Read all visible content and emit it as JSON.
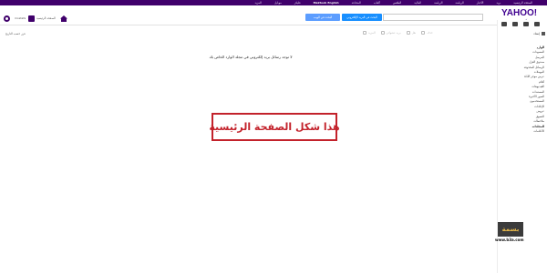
{
  "top_nav": {
    "items": [
      "الصفحة الرئيسية",
      "بريد",
      "الأخبار",
      "الرياضة",
      "الرياضة",
      "المالية",
      "الطقس",
      "ألعاب",
      "المحادثة",
      "Maktoob English",
      "فليكر",
      "موبايل",
      "المزيد"
    ],
    "bold": [
      "Maktoob English"
    ]
  },
  "header": {
    "logo": "YAHOO!",
    "logo_sub": "مكتوب",
    "search_value": "",
    "search_mail_button": "البحث في البريد الإلكتروني",
    "search_web_button": "البحث في الويب",
    "home_label": "الصفحة الرئيسية",
    "user_name": "mostafa"
  },
  "toolbar": {
    "sort_label": "فرز حسب التاريخ",
    "tools": [
      "حذف",
      "نقل",
      "بريد عشوائي",
      "المزيد"
    ]
  },
  "sidebar": {
    "compose": "إنشاء",
    "folders": [
      "الوارد",
      "المسودات",
      "المرسل",
      "صندوق العزل",
      "الرسائل المحذوفة",
      "المهملات",
      "عرض موجز الأداة",
      "أفلام",
      "الفيديوهات",
      "المستندات",
      "الصور الأخيرة",
      "المستخدمون",
      "الإعلانات",
      "عروض",
      "التسوق",
      "ملاحظات",
      "المجلدات",
      "الأعلامات"
    ],
    "sections": [
      "الوارد",
      "المجلدات"
    ]
  },
  "main": {
    "empty_message": "لا توجد رسائل بريد إلكتروني في مجلد الوارد الخاص بك",
    "callout": "هذا شكل الصفحة الرئيسية"
  },
  "watermark": {
    "logo": "بسمة",
    "url": "www.b3a.com"
  }
}
